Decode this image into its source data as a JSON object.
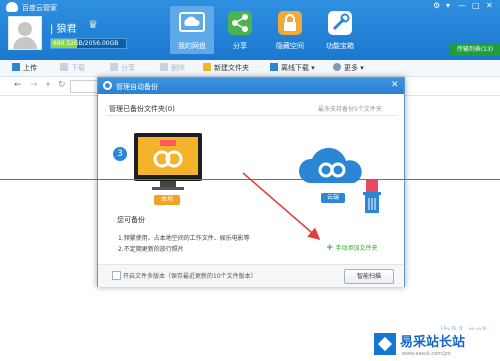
{
  "window": {
    "title": "百度云管家",
    "controls": [
      "⚙",
      "▾",
      "—",
      "□",
      "✕"
    ]
  },
  "user": {
    "name": "| 狼君",
    "quota_used": "690.52",
    "quota_total": "GB/2056.00GB",
    "quota_fraction": 0.34
  },
  "nav": {
    "tabs": [
      {
        "label": "我的网盘",
        "icon": "cloud-drive-icon",
        "color": "#ffffff"
      },
      {
        "label": "分享",
        "icon": "share-icon",
        "color": "#4cb34e"
      },
      {
        "label": "隐藏空间",
        "icon": "lock-icon",
        "color": "#f2a93a"
      },
      {
        "label": "功能宝箱",
        "icon": "tools-icon",
        "color": "#ffffff"
      }
    ]
  },
  "transfer": {
    "label": "传输列表(13)"
  },
  "toolbar": {
    "upload": "上传",
    "download": "下载",
    "share": "分享",
    "delete": "删除",
    "new_folder": "新建文件夹",
    "offline": "离线下载 ▾",
    "more": "更多 ▾"
  },
  "dialog": {
    "title": "管理自动备份",
    "subtitle": "管理已备份文件夹(0)",
    "max_hint": "最多支持备份5个文件夹",
    "step": "3",
    "local_label": "本地",
    "cloud_label": "云端",
    "can_backup": "您可备份",
    "hint1": "1.频繁使用、占本地空间的工作文件、娱乐电影等",
    "hint2": "2.不定期更新的旅行照片",
    "add_folder": "手动添加文件夹",
    "checkbox_label": "开启文件多版本（保存最近更新的10个文件版本）",
    "scan_button": "智能扫描"
  },
  "watermark": {
    "faint": "jb51.net",
    "name": "易采站长站",
    "url": "www.easck.com/jzz"
  },
  "colors": {
    "header": "#1b78cf",
    "accent": "#2c86d6",
    "annotation": "#e43b3b",
    "folder": "#f4b32a"
  }
}
